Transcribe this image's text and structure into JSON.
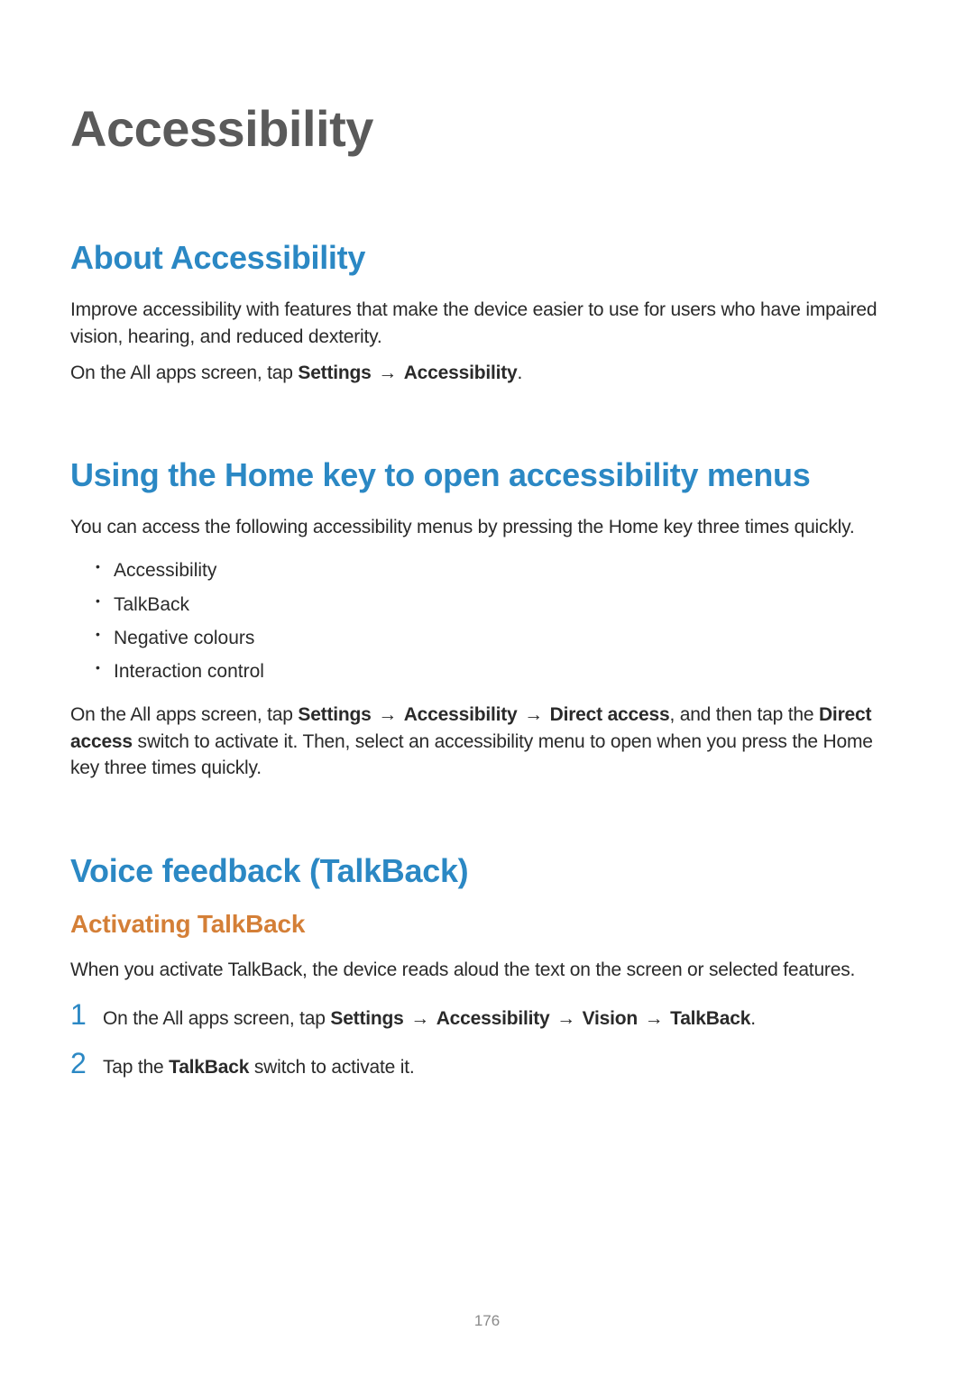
{
  "page": {
    "title": "Accessibility",
    "number": "176"
  },
  "sections": {
    "about": {
      "heading": "About Accessibility",
      "p1": "Improve accessibility with features that make the device easier to use for users who have impaired vision, hearing, and reduced dexterity.",
      "p2_prefix": "On the All apps screen, tap ",
      "p2_b1": "Settings",
      "p2_arrow": " → ",
      "p2_b2": "Accessibility",
      "p2_suffix": "."
    },
    "homekey": {
      "heading": "Using the Home key to open accessibility menus",
      "intro": "You can access the following accessibility menus by pressing the Home key three times quickly.",
      "items": [
        "Accessibility",
        "TalkBack",
        "Negative colours",
        "Interaction control"
      ],
      "out_prefix": "On the All apps screen, tap ",
      "out_b1": "Settings",
      "out_arrow1": " → ",
      "out_b2": "Accessibility",
      "out_arrow2": " → ",
      "out_b3": "Direct access",
      "out_mid": ", and then tap the ",
      "out_b4": "Direct access",
      "out_suffix": " switch to activate it. Then, select an accessibility menu to open when you press the Home key three times quickly."
    },
    "voice": {
      "heading": "Voice feedback (TalkBack)",
      "sub": "Activating TalkBack",
      "p1": "When you activate TalkBack, the device reads aloud the text on the screen or selected features.",
      "step1": {
        "num": "1",
        "prefix": "On the All apps screen, tap ",
        "b1": "Settings",
        "a1": " → ",
        "b2": "Accessibility",
        "a2": " → ",
        "b3": "Vision",
        "a3": " → ",
        "b4": "TalkBack",
        "suffix": "."
      },
      "step2": {
        "num": "2",
        "prefix": "Tap the ",
        "b1": "TalkBack",
        "suffix": " switch to activate it."
      }
    }
  }
}
